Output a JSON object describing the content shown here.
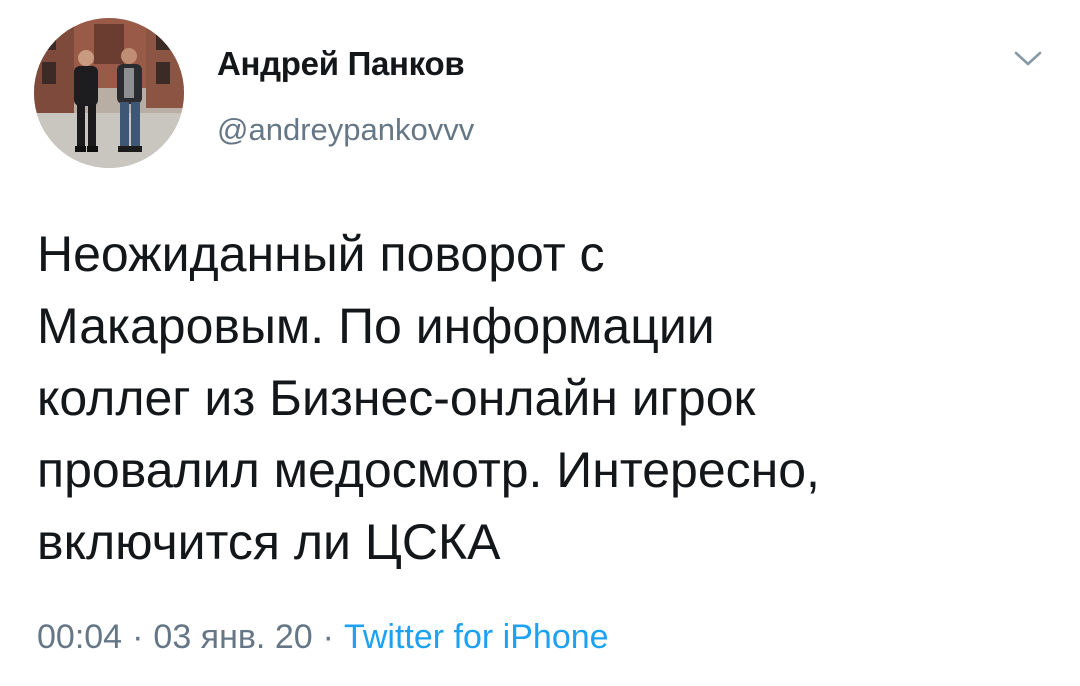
{
  "author": {
    "display_name": "Андрей Панков",
    "handle": "@andreypankovvv"
  },
  "menu": {
    "icon": "chevron-down-icon"
  },
  "tweet": {
    "lines": [
      "Неожиданный поворот с",
      "Макаровым. По информации",
      "коллег из Бизнес-онлайн игрок",
      "провалил медосмотр. Интересно,",
      "включится ли ЦСКА"
    ]
  },
  "meta": {
    "time": "00:04",
    "separator": "·",
    "date": "03 янв. 20",
    "source": "Twitter for iPhone"
  },
  "colors": {
    "text": "#14171a",
    "secondary": "#657786",
    "link": "#1da1f2"
  }
}
